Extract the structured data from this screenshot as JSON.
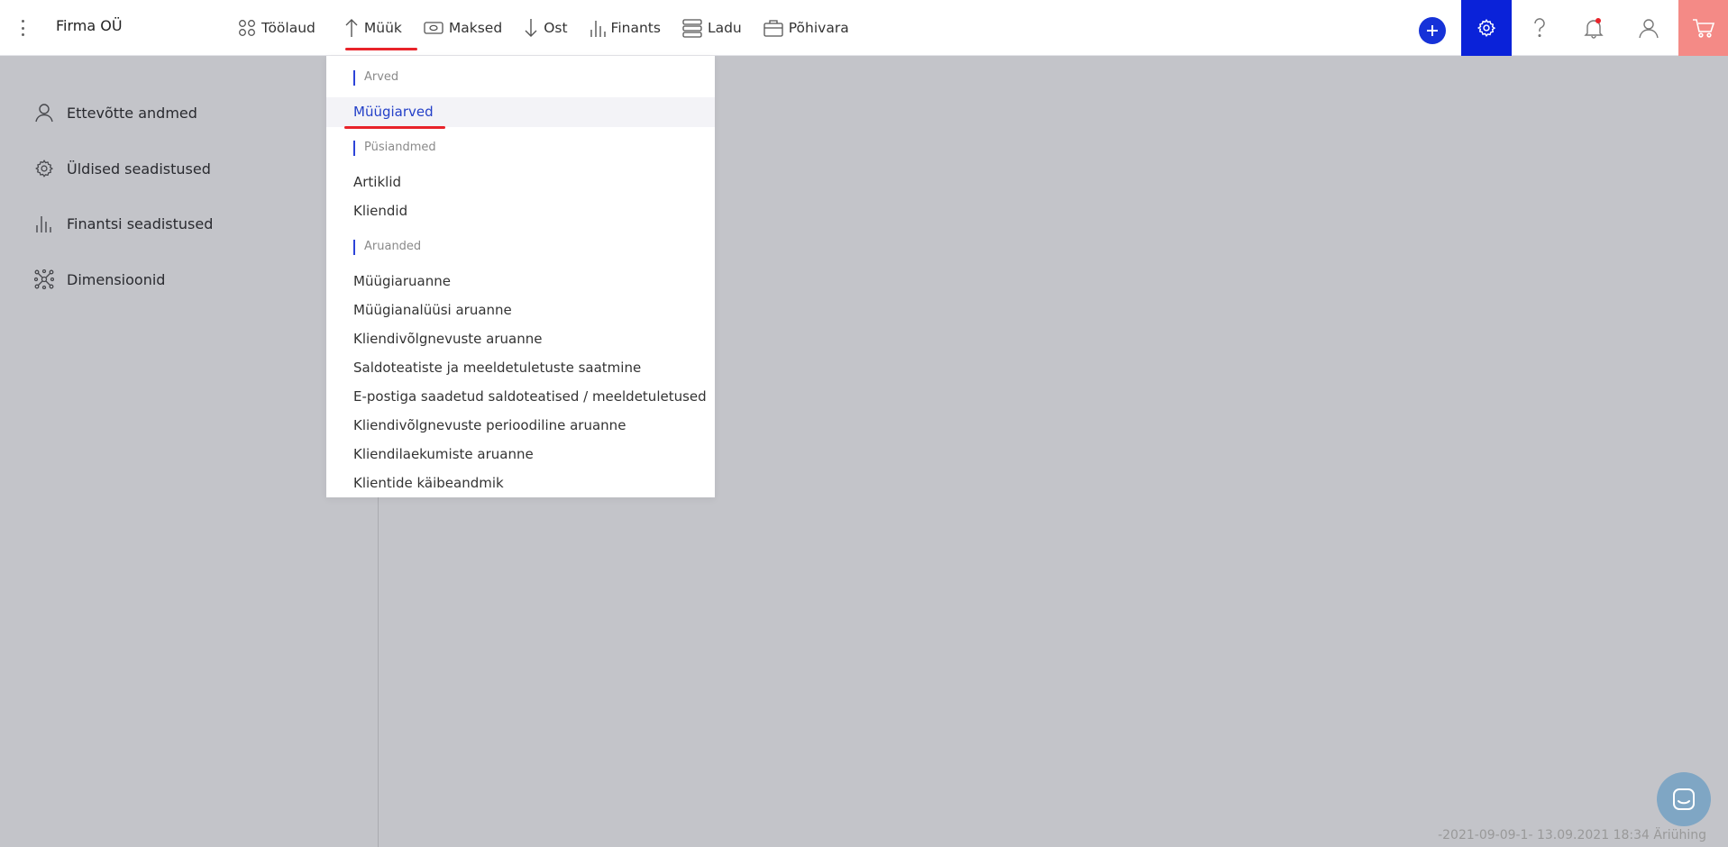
{
  "header": {
    "company_name": "Firma OÜ",
    "nav": [
      {
        "label": "Töölaud",
        "icon": "dashboard-icon"
      },
      {
        "label": "Müük",
        "icon": "arrow-up-icon"
      },
      {
        "label": "Maksed",
        "icon": "money-icon"
      },
      {
        "label": "Ost",
        "icon": "arrow-down-icon"
      },
      {
        "label": "Finants",
        "icon": "bar-chart-icon"
      },
      {
        "label": "Ladu",
        "icon": "stack-icon"
      },
      {
        "label": "Põhivara",
        "icon": "briefcase-icon"
      }
    ],
    "active_nav": "Müük"
  },
  "sidebar": {
    "items": [
      {
        "label": "Ettevõtte andmed",
        "icon": "person-icon"
      },
      {
        "label": "Üldised seadistused",
        "icon": "gear-icon"
      },
      {
        "label": "Finantsi seadistused",
        "icon": "bar-chart-icon"
      },
      {
        "label": "Dimensioonid",
        "icon": "network-icon"
      }
    ]
  },
  "dropdown": {
    "sections": [
      {
        "heading": "Arved",
        "items": [
          "Müügiarved"
        ]
      },
      {
        "heading": "Püsiandmed",
        "items": [
          "Artiklid",
          "Kliendid"
        ]
      },
      {
        "heading": "Aruanded",
        "items": [
          "Müügiaruanne",
          "Müügianalüüsi aruanne",
          "Kliendivõlgnevuste aruanne",
          "Saldoteatiste ja meeldetuletuste saatmine",
          "E-postiga saadetud saldoteatised / meeldetuletused",
          "Kliendivõlgnevuste perioodiline aruanne",
          "Kliendilaekumiste aruanne",
          "Klientide käibeandmik"
        ]
      }
    ],
    "active_item": "Müügiarved"
  },
  "footer": {
    "text": "-2021-09-09-1- 13.09.2021 18:34 Äriühing"
  },
  "colors": {
    "accent_blue": "#0a22d9",
    "active_red": "#e8232a",
    "cart_bg": "#f48a86",
    "chat_bg": "#7fa6c4"
  }
}
